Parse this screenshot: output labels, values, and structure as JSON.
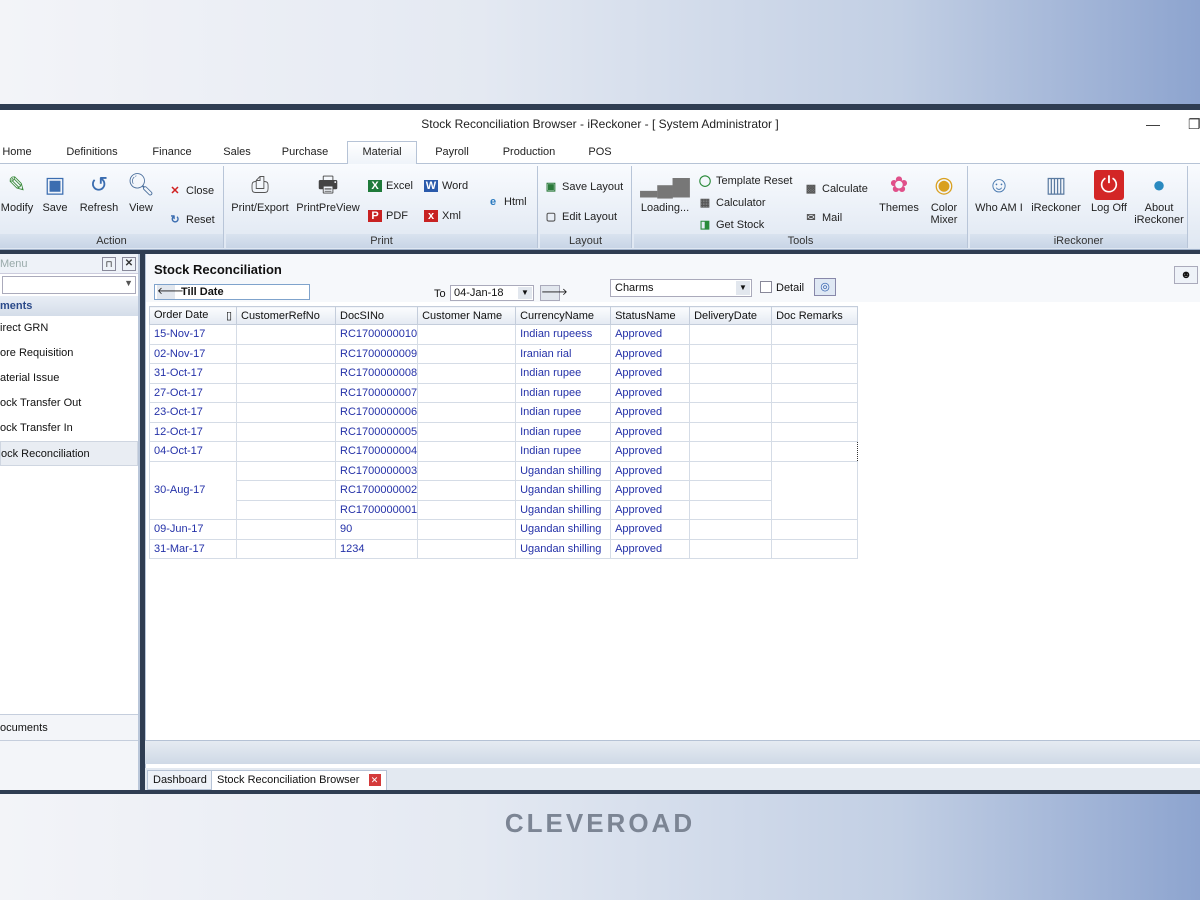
{
  "window": {
    "title": "Stock  Reconciliation  Browser - iReckoner -  [ System Administrator ]"
  },
  "tabs": [
    "Home",
    "Definitions",
    "Finance",
    "Sales",
    "Purchase",
    "Material",
    "Payroll",
    "Production",
    "POS"
  ],
  "ribbon": {
    "action": {
      "label": "Action",
      "modify": "Modify",
      "save": "Save",
      "refresh": "Refresh",
      "view": "View",
      "close": "Close",
      "reset": "Reset"
    },
    "print": {
      "label": "Print",
      "print_export": "Print/Export",
      "print_preview": "PrintPreView",
      "excel": "Excel",
      "pdf": "PDF",
      "word": "Word",
      "xml": "Xml",
      "html": "Html"
    },
    "layout": {
      "label": "Layout",
      "save_layout": "Save Layout",
      "edit_layout": "Edit Layout"
    },
    "tools": {
      "label": "Tools",
      "loading": "Loading...",
      "template_reset": "Template Reset",
      "calculator": "Calculator",
      "get_stock": "Get Stock",
      "calculate": "Calculate",
      "mail": "Mail",
      "themes": "Themes",
      "color_mixer_1": "Color",
      "color_mixer_2": "Mixer"
    },
    "ireckoner": {
      "label": "iReckoner",
      "who_am_i": "Who AM I",
      "ireckoner": "iReckoner",
      "log_off": "Log Off",
      "about_1": "About",
      "about_2": "iReckoner"
    }
  },
  "left_panel": {
    "header": "Menu",
    "section": "ments",
    "items": [
      "irect GRN",
      "ore Requisition",
      "aterial Issue",
      "ock Transfer Out",
      "ock Transfer In",
      "ock Reconciliation"
    ],
    "bottom": "ocuments"
  },
  "main": {
    "title": "Stock  Reconciliation",
    "till_date": "Till Date",
    "to_label": "To",
    "to_date": "04-Jan-18",
    "theme_combo": "Charms",
    "detail_label": "Detail",
    "columns": [
      "Order Date",
      "CustomerRefNo",
      "DocSINo",
      "Customer Name",
      "CurrencyName",
      "StatusName",
      "DeliveryDate",
      "Doc Remarks"
    ],
    "rows": [
      {
        "date": "15-Nov-17",
        "doc": "RC1700000010",
        "currency": "Indian rupeess",
        "status": "Approved"
      },
      {
        "date": "02-Nov-17",
        "doc": "RC1700000009",
        "currency": "Iranian rial",
        "status": "Approved"
      },
      {
        "date": "31-Oct-17",
        "doc": "RC1700000008",
        "currency": "Indian rupee",
        "status": "Approved"
      },
      {
        "date": "27-Oct-17",
        "doc": "RC1700000007",
        "currency": "Indian rupee",
        "status": "Approved"
      },
      {
        "date": "23-Oct-17",
        "doc": "RC1700000006",
        "currency": "Indian rupee",
        "status": "Approved"
      },
      {
        "date": "12-Oct-17",
        "doc": "RC1700000005",
        "currency": "Indian rupee",
        "status": "Approved"
      },
      {
        "date": "04-Oct-17",
        "doc": "RC1700000004",
        "currency": "Indian rupee",
        "status": "Approved"
      },
      {
        "date": "30-Aug-17",
        "doc": "RC1700000003",
        "currency": "Ugandan shilling",
        "status": "Approved"
      },
      {
        "date": "",
        "doc": "RC1700000002",
        "currency": "Ugandan shilling",
        "status": "Approved"
      },
      {
        "date": "",
        "doc": "RC1700000001",
        "currency": "Ugandan shilling",
        "status": "Approved"
      },
      {
        "date": "09-Jun-17",
        "doc": "90",
        "currency": "Ugandan shilling",
        "status": "Approved"
      },
      {
        "date": "31-Mar-17",
        "doc": "1234",
        "currency": "Ugandan shilling",
        "status": "Approved"
      }
    ]
  },
  "doc_tabs": [
    "Dashboard",
    "Stock  Reconciliation  Browser"
  ],
  "brand": "CLEVEROAD",
  "colors": {
    "link_text": "#2431a8",
    "header_text": "#2b4a8a"
  }
}
